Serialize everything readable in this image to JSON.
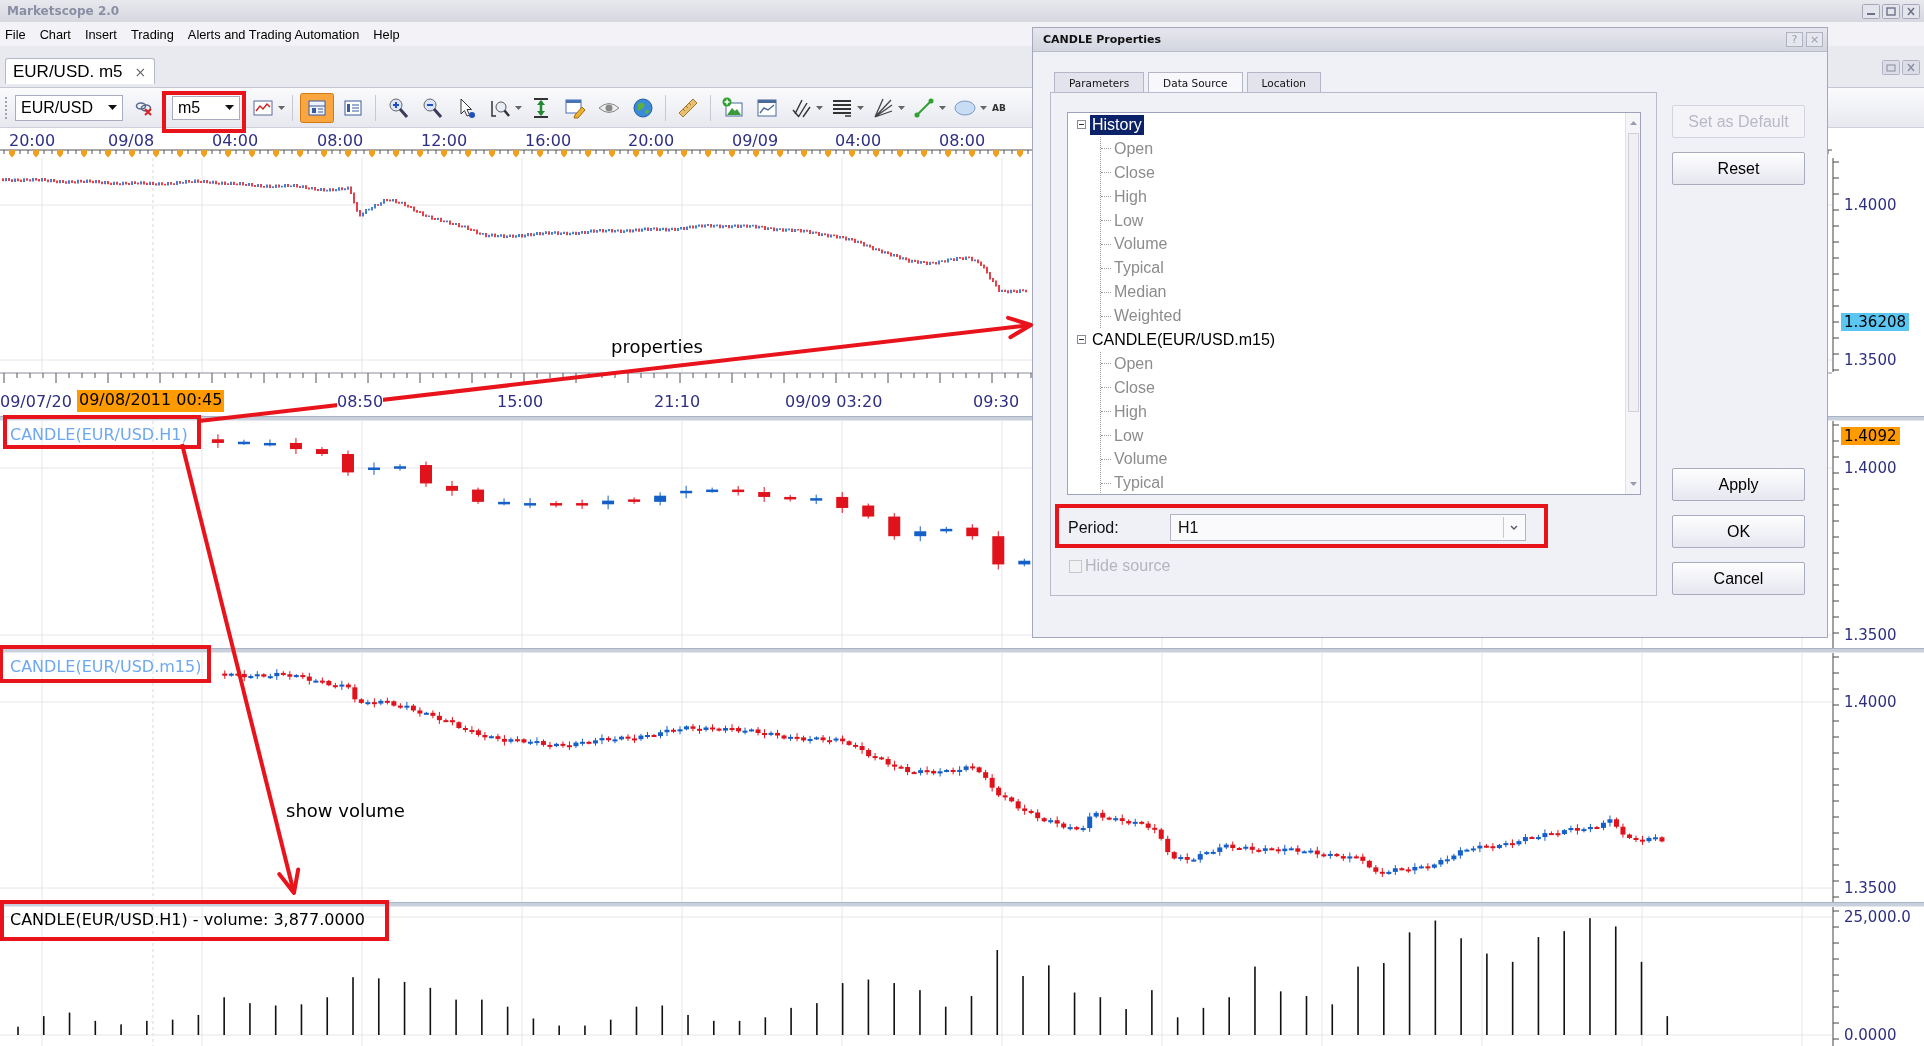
{
  "window": {
    "title": "Marketscope 2.0"
  },
  "menu": [
    "File",
    "Chart",
    "Insert",
    "Trading",
    "Alerts and Trading Automation",
    "Help"
  ],
  "document_tabs": [
    {
      "label": "EUR/USD. m5",
      "close": "×",
      "selected": true
    }
  ],
  "toolbar": {
    "symbol": "EUR/USD",
    "period": "m5",
    "tool_groups": [
      {
        "tools": [
          {
            "kind": "chart",
            "on": false,
            "menu": true
          }
        ]
      },
      {
        "tools": [
          {
            "kind": "panel",
            "on": true,
            "menu": false
          },
          {
            "kind": "legend",
            "on": false,
            "menu": false
          }
        ]
      },
      {
        "tools": [
          {
            "kind": "zoomin",
            "on": false,
            "menu": false
          },
          {
            "kind": "zoomout",
            "on": false,
            "menu": false
          },
          {
            "kind": "pointer",
            "on": false,
            "menu": false
          },
          {
            "kind": "zoomrange",
            "on": false,
            "menu": true
          },
          {
            "kind": "fit",
            "on": false,
            "menu": false
          },
          {
            "kind": "note",
            "on": false,
            "menu": false
          },
          {
            "kind": "eye",
            "on": false,
            "menu": false
          },
          {
            "kind": "globe",
            "on": false,
            "menu": false
          }
        ]
      },
      {
        "tools": [
          {
            "kind": "ruler",
            "on": false,
            "menu": false
          }
        ]
      },
      {
        "tools": [
          {
            "kind": "picture",
            "on": false,
            "menu": false
          },
          {
            "kind": "window",
            "on": false,
            "menu": false
          },
          {
            "kind": "fork",
            "on": false,
            "menu": true
          },
          {
            "kind": "levels",
            "on": false,
            "menu": true
          },
          {
            "kind": "fan",
            "on": false,
            "menu": true
          },
          {
            "kind": "line",
            "on": false,
            "menu": true
          },
          {
            "kind": "ellipse",
            "on": false,
            "menu": true
          },
          {
            "kind": "text",
            "on": false,
            "menu": false,
            "label": "AB"
          }
        ]
      }
    ]
  },
  "time_axis_top": [
    "20:00",
    "09/08",
    "04:00",
    "08:00",
    "12:00",
    "16:00",
    "20:00",
    "09/09",
    "04:00",
    "08:00"
  ],
  "time_axis_bottom": {
    "labels": [
      "09/07/20",
      "08:50",
      "15:00",
      "21:10",
      "09/09 03:20",
      "09:30"
    ],
    "cursor": "09/08/2011 00:45"
  },
  "panels": [
    {
      "kind": "line",
      "axis": [
        {
          "label": "1.4000"
        },
        {
          "label": "1.36208",
          "color": "#5cc6f2"
        },
        {
          "label": "1.3500"
        }
      ]
    },
    {
      "kind": "candles",
      "caption": "CANDLE(EUR/USD.H1)",
      "axis": [
        {
          "label": "1.4092",
          "color": "#ff9a00"
        },
        {
          "label": "1.4000"
        },
        {
          "label": "1.3500"
        }
      ]
    },
    {
      "kind": "candles",
      "caption": "CANDLE(EUR/USD.m15)",
      "axis": [
        {
          "label": "1.4000"
        },
        {
          "label": "1.3500"
        }
      ]
    },
    {
      "kind": "volume",
      "caption": "CANDLE(EUR/USD.H1) - volume: 3,877.0000",
      "axis": [
        {
          "label": "25,000.0"
        },
        {
          "label": "0.0000"
        }
      ]
    }
  ],
  "dialog": {
    "title": "CANDLE Properties",
    "help": "?",
    "close": "×",
    "tabs": [
      {
        "label": "Parameters",
        "selected": false
      },
      {
        "label": "Data Source",
        "selected": true
      },
      {
        "label": "Location",
        "selected": false
      }
    ],
    "tree": [
      {
        "label": "History",
        "selected": true,
        "expanded": true,
        "children": [
          {
            "label": "Open",
            "selected": false,
            "disabled": true
          },
          {
            "label": "Close",
            "selected": false,
            "disabled": true
          },
          {
            "label": "High",
            "selected": false,
            "disabled": true
          },
          {
            "label": "Low",
            "selected": false,
            "disabled": true
          },
          {
            "label": "Volume",
            "selected": false,
            "disabled": true
          },
          {
            "label": "Typical",
            "selected": false,
            "disabled": true
          },
          {
            "label": "Median",
            "selected": false,
            "disabled": true
          },
          {
            "label": "Weighted",
            "selected": false,
            "disabled": true
          }
        ]
      },
      {
        "label": "CANDLE(EUR/USD.m15)",
        "selected": false,
        "expanded": true,
        "children": [
          {
            "label": "Open",
            "selected": false,
            "disabled": true
          },
          {
            "label": "Close",
            "selected": false,
            "disabled": true
          },
          {
            "label": "High",
            "selected": false,
            "disabled": true
          },
          {
            "label": "Low",
            "selected": false,
            "disabled": true
          },
          {
            "label": "Volume",
            "selected": false,
            "disabled": true
          },
          {
            "label": "Typical",
            "selected": false,
            "disabled": true
          }
        ]
      }
    ],
    "period": {
      "label": "Period:",
      "value": "H1"
    },
    "hide_source": {
      "label": "Hide source",
      "checked": false,
      "disabled": true
    },
    "buttons": [
      {
        "label": "Set as Default",
        "disabled": true
      },
      {
        "label": "Reset",
        "disabled": false
      },
      {
        "label": "Apply",
        "disabled": false
      },
      {
        "label": "OK",
        "disabled": false
      },
      {
        "label": "Cancel",
        "disabled": false
      }
    ]
  },
  "annotations": [
    "properties",
    "show volume"
  ]
}
